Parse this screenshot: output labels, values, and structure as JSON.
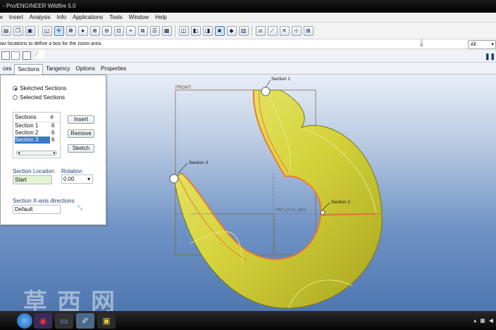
{
  "window": {
    "title": "- Pro/ENGINEER Wildfire 5.0"
  },
  "menu": [
    "w",
    "Insert",
    "Analysis",
    "Info",
    "Applications",
    "Tools",
    "Window",
    "Help"
  ],
  "message": "wo locations to define a box for the zoom area.",
  "filter": {
    "value": "All"
  },
  "tabs": [
    "ces",
    "Sections",
    "Tangency",
    "Options",
    "Properties"
  ],
  "panel": {
    "radio_sketched": "Sketched Sections",
    "radio_selected": "Selected Sections",
    "list_header_sections": "Sections",
    "list_header_num": "#",
    "sections": [
      {
        "name": "Section 1",
        "count": "6"
      },
      {
        "name": "Section 2",
        "count": "6"
      },
      {
        "name": "Section 3",
        "count": "6"
      }
    ],
    "btn_insert": "Insert",
    "btn_remove": "Remove",
    "btn_sketch": "Sketch",
    "section_location_label": "Section Location",
    "section_location_value": "Start",
    "rotation_label": "Rotation",
    "rotation_value": "0.00",
    "xaxis_label": "Section X-axis directions",
    "xaxis_value": "Default"
  },
  "viewport": {
    "plane_label": "FRONT",
    "section1": "Section 1",
    "section2": "Section 2",
    "section3": "Section 3",
    "curve_label": "PNT_CTYL_DEF"
  },
  "watermark": "草西网",
  "colors": {
    "model": "#d4d23a",
    "edge": "#f07a2c",
    "accent": "#3b78c4"
  }
}
